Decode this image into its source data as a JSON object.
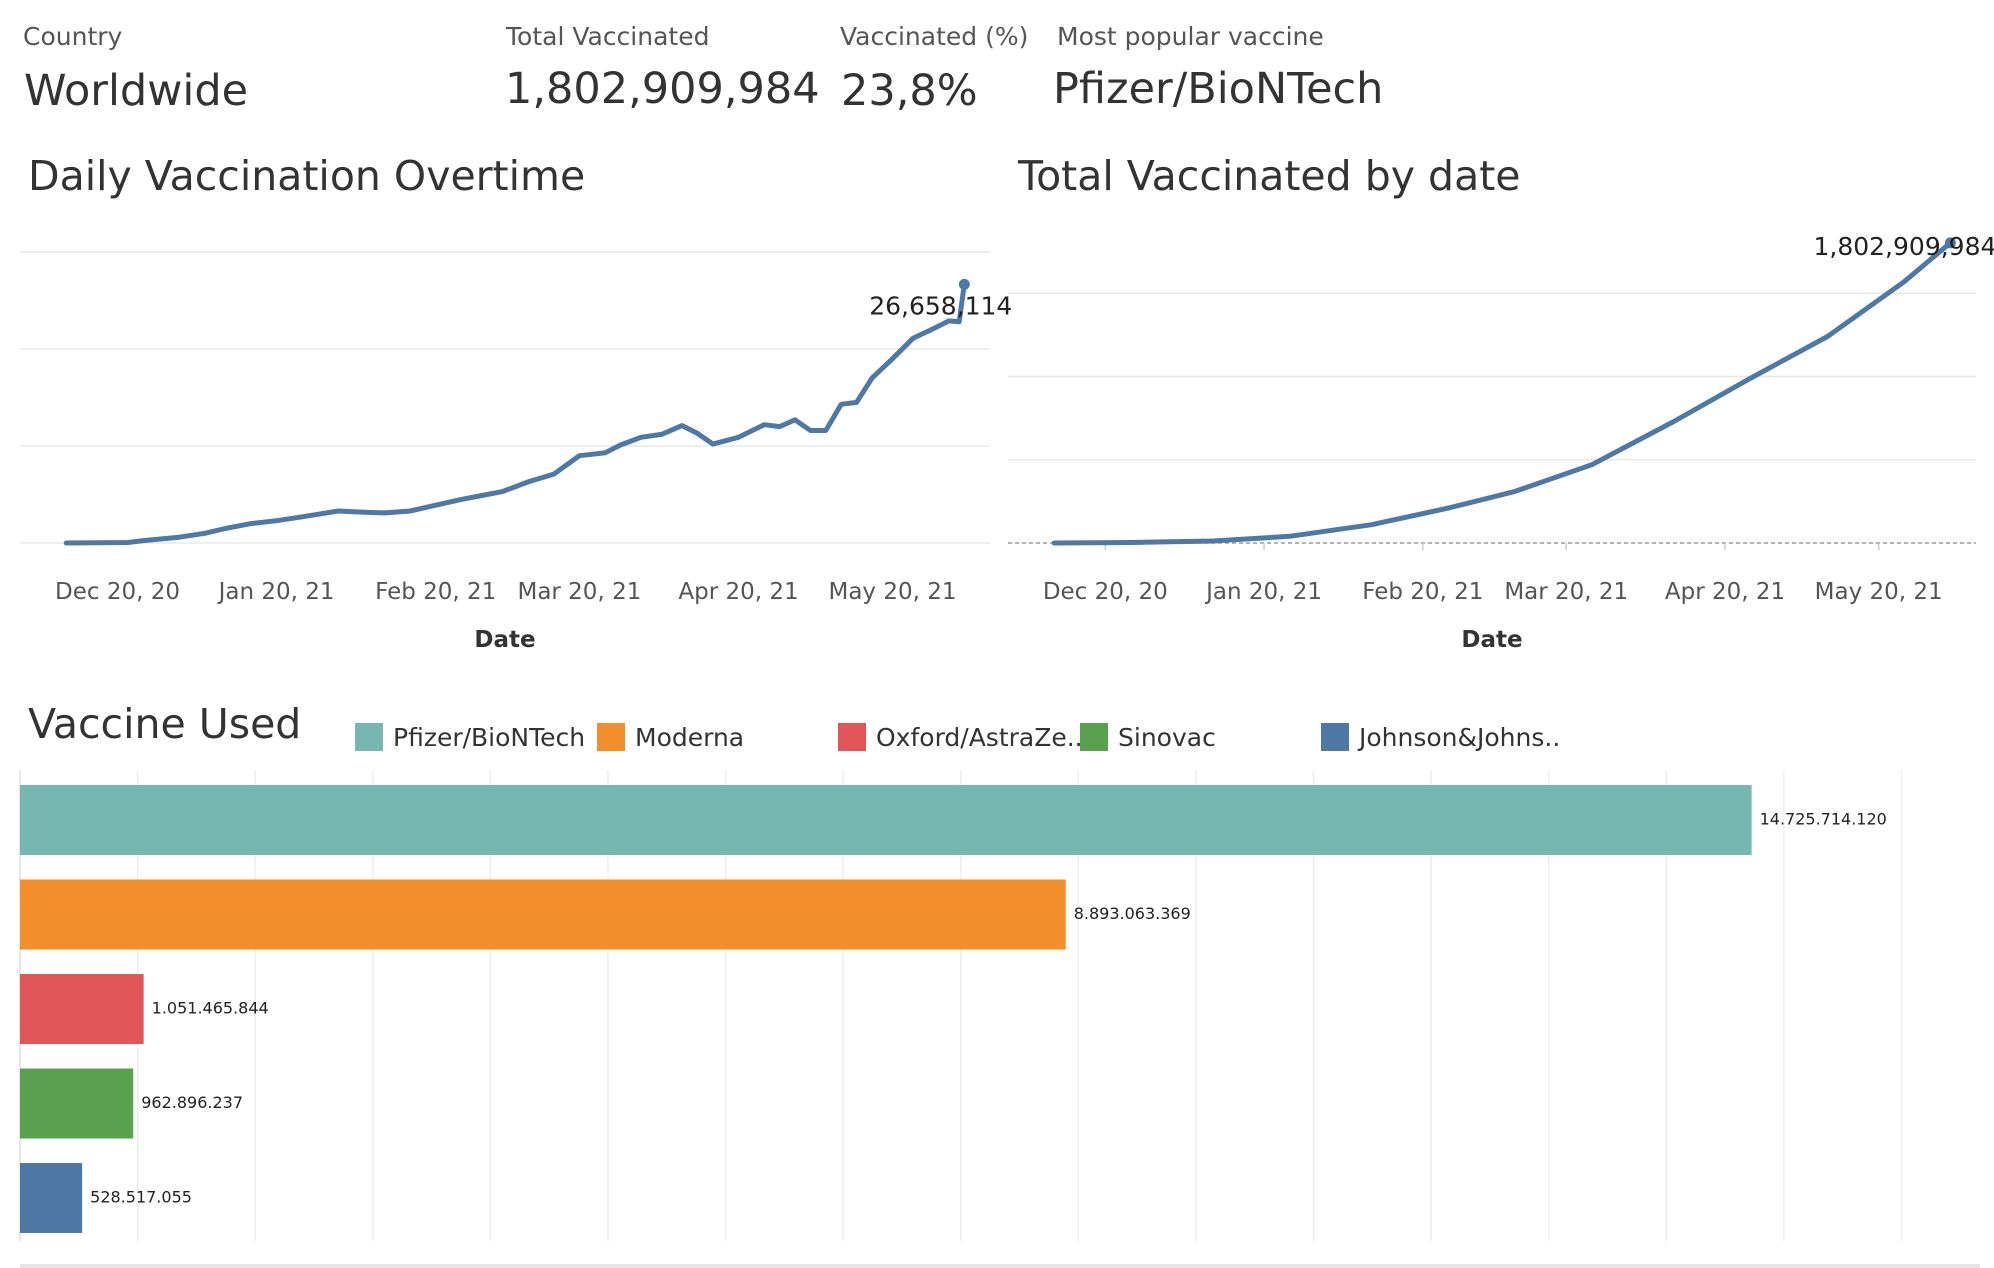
{
  "kpis": {
    "country": {
      "label": "Country",
      "value": "Worldwide"
    },
    "total_vaccinated": {
      "label": "Total Vaccinated",
      "value": "1,802,909,984"
    },
    "vaccinated_pct": {
      "label": "Vaccinated (%)",
      "value": "23,8%"
    },
    "popular_vaccine": {
      "label": "Most popular vaccine",
      "value": "Pfizer/BioNTech"
    }
  },
  "colors": {
    "line": "#4e79a7",
    "pfizer": "#76b7b2",
    "moderna": "#f28e2b",
    "oxford": "#e15759",
    "sinovac": "#59a14f",
    "johnson": "#4e79a7",
    "grid": "#e8e8e8"
  },
  "chart_data": [
    {
      "type": "line",
      "title": "Daily Vaccination Overtime",
      "xlabel": "Date",
      "ylabel": "",
      "x_tick_labels": [
        "Dec 20, 20",
        "Jan 20, 21",
        "Feb 20, 21",
        "Mar 20, 21",
        "Apr 20, 21",
        "May 20, 21"
      ],
      "x_ticks": [
        "2020-12-20",
        "2021-01-20",
        "2021-02-20",
        "2021-03-20",
        "2021-04-20",
        "2021-05-20"
      ],
      "xlim": [
        "2020-12-01",
        "2021-06-08"
      ],
      "ylim": [
        0,
        30000000
      ],
      "grid": "horizontal",
      "y_tick_labels_shown": false,
      "series": [
        {
          "x": [
            "2020-12-10",
            "2020-12-22",
            "2020-12-25",
            "2021-01-01",
            "2021-01-06",
            "2021-01-10",
            "2021-01-15",
            "2021-01-20",
            "2021-01-25",
            "2021-02-01",
            "2021-02-05",
            "2021-02-10",
            "2021-02-15",
            "2021-02-20",
            "2021-02-25",
            "2021-03-01",
            "2021-03-05",
            "2021-03-10",
            "2021-03-15",
            "2021-03-20",
            "2021-03-25",
            "2021-03-28",
            "2021-04-01",
            "2021-04-05",
            "2021-04-09",
            "2021-04-12",
            "2021-04-15",
            "2021-04-20",
            "2021-04-25",
            "2021-04-28",
            "2021-05-01",
            "2021-05-04",
            "2021-05-07",
            "2021-05-10",
            "2021-05-13",
            "2021-05-16",
            "2021-05-20",
            "2021-05-24",
            "2021-05-28",
            "2021-05-31",
            "2021-06-02",
            "2021-06-03"
          ],
          "y": [
            0,
            50000,
            250000,
            600000,
            1000000,
            1500000,
            2000000,
            2300000,
            2700000,
            3300000,
            3200000,
            3100000,
            3300000,
            3900000,
            4500000,
            4900000,
            5300000,
            6300000,
            7100000,
            9000000,
            9300000,
            10100000,
            10900000,
            11200000,
            12100000,
            11300000,
            10200000,
            10900000,
            12200000,
            12000000,
            12700000,
            11600000,
            11600000,
            14300000,
            14500000,
            17000000,
            19000000,
            21100000,
            22100000,
            22900000,
            22800000,
            26658114
          ],
          "end_label": "26,658,114"
        }
      ]
    },
    {
      "type": "line",
      "title": "Total Vaccinated by date",
      "xlabel": "Date",
      "ylabel": "",
      "x_tick_labels": [
        "Dec 20, 20",
        "Jan 20, 21",
        "Feb 20, 21",
        "Mar 20, 21",
        "Apr 20, 21",
        "May 20, 21"
      ],
      "x_ticks": [
        "2020-12-20",
        "2021-01-20",
        "2021-02-20",
        "2021-03-20",
        "2021-04-20",
        "2021-05-20"
      ],
      "xlim": [
        "2020-12-01",
        "2021-06-08"
      ],
      "ylim": [
        0,
        2000000000
      ],
      "grid": "horizontal",
      "y_tick_labels_shown": false,
      "series": [
        {
          "x": [
            "2020-12-10",
            "2020-12-25",
            "2021-01-10",
            "2021-01-25",
            "2021-02-10",
            "2021-02-25",
            "2021-03-10",
            "2021-03-25",
            "2021-04-10",
            "2021-04-25",
            "2021-05-10",
            "2021-05-25",
            "2021-06-03"
          ],
          "y": [
            0,
            3000000,
            12000000,
            40000000,
            110000000,
            210000000,
            310000000,
            470000000,
            730000000,
            990000000,
            1240000000,
            1570000000,
            1802909984
          ],
          "end_label": "1,802,909,984"
        }
      ]
    },
    {
      "type": "bar",
      "orientation": "horizontal",
      "title": "Vaccine Used",
      "legend_placement": "top",
      "categories": [
        "Pfizer/BioNTech",
        "Moderna",
        "Oxford/AstraZe..",
        "Sinovac",
        "Johnson&Johns.."
      ],
      "values": [
        14725714120,
        8893063369,
        1051465844,
        962896237,
        528517055
      ],
      "value_labels": [
        "14.725.714.120",
        "8.893.063.369",
        "1.051.465.844",
        "962.896.237",
        "528.517.055"
      ],
      "xlim": [
        0,
        16600000000
      ],
      "grid": "vertical"
    }
  ]
}
